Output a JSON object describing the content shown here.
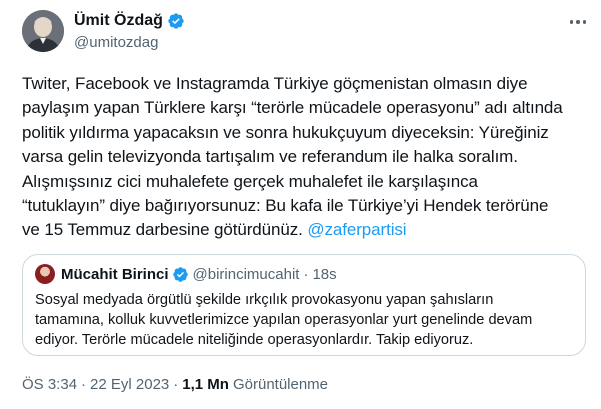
{
  "author": {
    "name": "Ümit Özdağ",
    "handle": "@umitozdag",
    "verified": true,
    "verified_color": "#1d9bf0"
  },
  "tweet": {
    "lines": [
      "Twiter, Facebook ve Instagramda Türkiye göçmenistan olmasın diye",
      "paylaşım yapan Türklere karşı “terörle mücadele operasyonu” adı altında",
      "politik yıldırma yapacaksın ve sonra hukukçuyum diyeceksin: Yüreğiniz",
      "varsa gelin televizyonda tartışalım ve referandum ile halka soralım.",
      "Alışmışsınız cici muhalefete gerçek muhalefet ile karşılaşınca",
      "“tutuklayın” diye bağırıyorsunuz: Bu kafa ile Türkiye’yi Hendek terörüne",
      "ve 15 Temmuz darbesine götürdünüz. "
    ],
    "mention": "@zaferpartisi"
  },
  "quote": {
    "name": "Mücahit Birinci",
    "handle": "@birincimucahit",
    "dot": "·",
    "time": "18s",
    "lines": [
      "Sosyal medyada örgütlü şekilde ırkçılık provokasyonu yapan şahısların",
      "tamamına, kolluk kuvvetlerimizce yapılan operasyonlar yurt genelinde devam",
      "ediyor. Terörle mücadele niteliğinde operasyonlardır. Takip ediyoruz."
    ]
  },
  "meta": {
    "time": "ÖS 3:34",
    "sep": "·",
    "date": "22 Eyl 2023",
    "views_count": "1,1 Mn",
    "views_label": "Görüntülenme"
  },
  "icons": {
    "more": "more-horizontal-icon",
    "verified": "verified-badge-icon"
  },
  "colors": {
    "link": "#1d9bf0",
    "secondary_text": "#536471",
    "border": "#cfd9de"
  }
}
